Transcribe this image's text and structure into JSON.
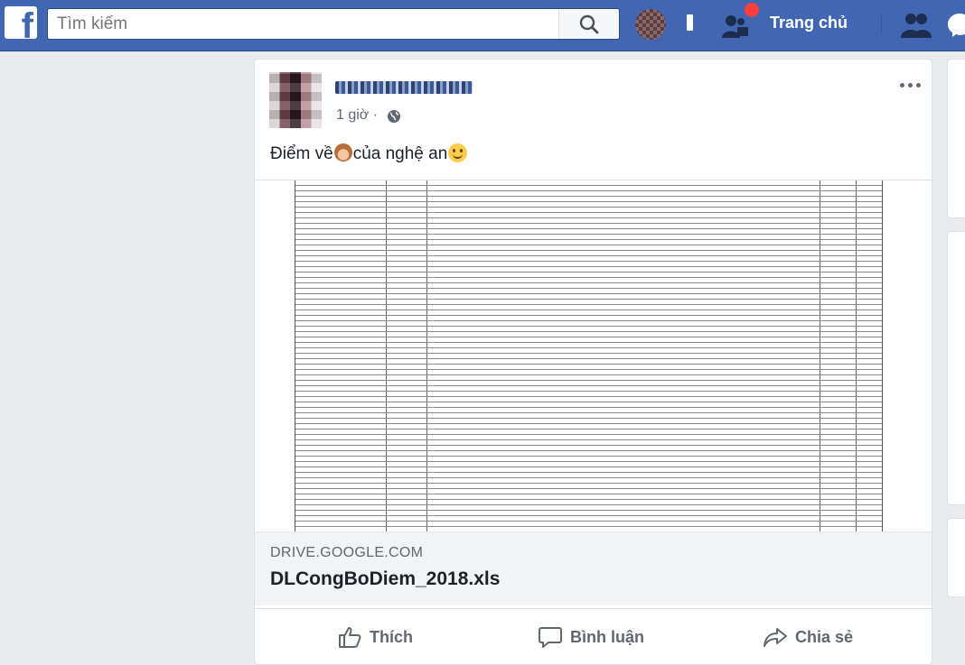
{
  "topbar": {
    "logo_letter": "f",
    "search_placeholder": "Tìm kiếm",
    "home_label": "Trang chủ",
    "brand_color": "#4267b2",
    "icons": [
      "search-icon",
      "friend-requests-icon",
      "friends-icon",
      "messenger-icon"
    ]
  },
  "post": {
    "time": "1 giờ ·",
    "text_before": "Điểm về",
    "text_middle": "của nghệ an",
    "link": {
      "domain": "DRIVE.GOOGLE.COM",
      "title": "DLCongBoDiem_2018.xls"
    },
    "actions": {
      "like": "Thích",
      "comment": "Bình luận",
      "share": "Chia sẻ"
    }
  }
}
